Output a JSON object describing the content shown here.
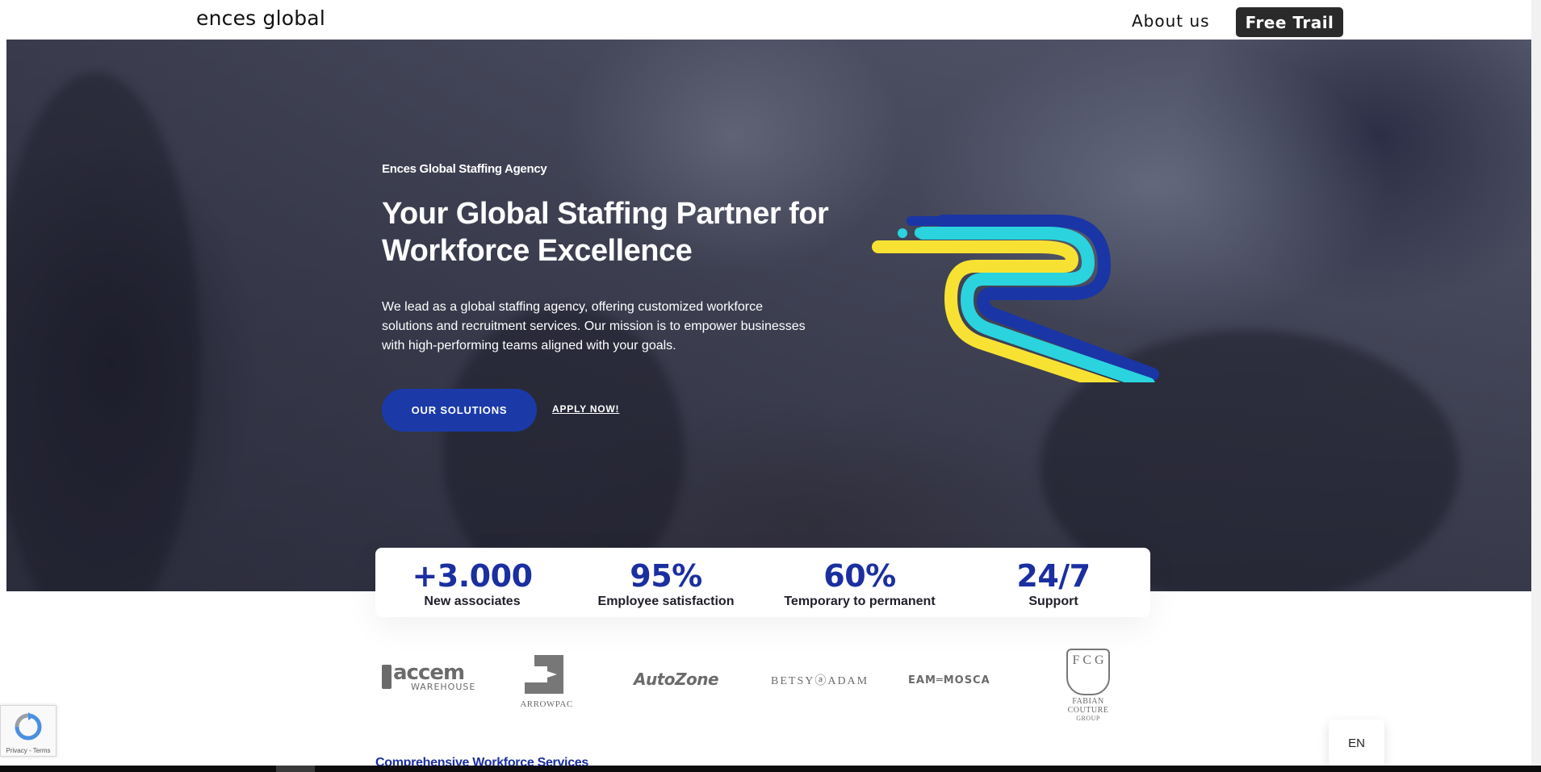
{
  "nav": {
    "brand": "ences global",
    "about": "About us",
    "trial": "Free Trail"
  },
  "hero": {
    "eyebrow": "Ences Global Staffing Agency",
    "headline": "Your Global Staffing Partner for Workforce Excellence",
    "lead": "We lead as a global staffing agency, offering customized workforce solutions and recruitment services. Our mission is to empower businesses with high-performing teams aligned with your goals.",
    "primary_cta": "OUR SOLUTIONS",
    "secondary_cta": "APPLY NOW!"
  },
  "stats": [
    {
      "value": "+3.000",
      "label": "New associates"
    },
    {
      "value": "95%",
      "label": "Employee satisfaction"
    },
    {
      "value": "60%",
      "label": "Temporary to permanent"
    },
    {
      "value": "24/7",
      "label": "Support"
    }
  ],
  "clients": {
    "accem_big": "accem",
    "accem_small": "WAREHOUSE",
    "arrowpac": "ARROWPAC",
    "autozone": "AutoZone",
    "betsy": "BETSYⓐADAM",
    "eam": "EAM═MOSCA",
    "fcg_letters": "F C G",
    "fcg_name": "FABIAN COUTURE",
    "fcg_group": "GROUP"
  },
  "section_peek": "Comprehensive Workforce Services",
  "recaptcha": {
    "label": "Privacy - Terms"
  },
  "language": "EN",
  "colors": {
    "primary": "#1b3aa8",
    "stat_blue": "#1b2fa0",
    "logo_navy": "#1a35a6",
    "logo_cyan": "#2ad3dd",
    "logo_yellow": "#f7e234",
    "trial_bg": "#2a2a2a"
  }
}
